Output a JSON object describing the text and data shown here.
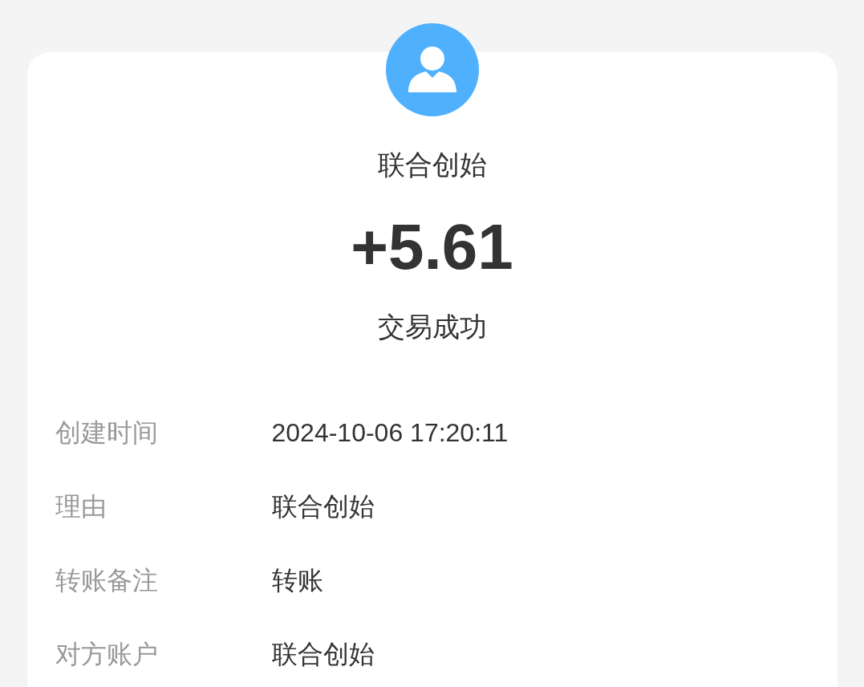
{
  "payee": {
    "name": "联合创始"
  },
  "amount": "+5.61",
  "status": "交易成功",
  "details": [
    {
      "label": "创建时间",
      "value": "2024-10-06 17:20:11"
    },
    {
      "label": "理由",
      "value": "联合创始"
    },
    {
      "label": "转账备注",
      "value": "转账"
    },
    {
      "label": "对方账户",
      "value": "联合创始"
    }
  ]
}
